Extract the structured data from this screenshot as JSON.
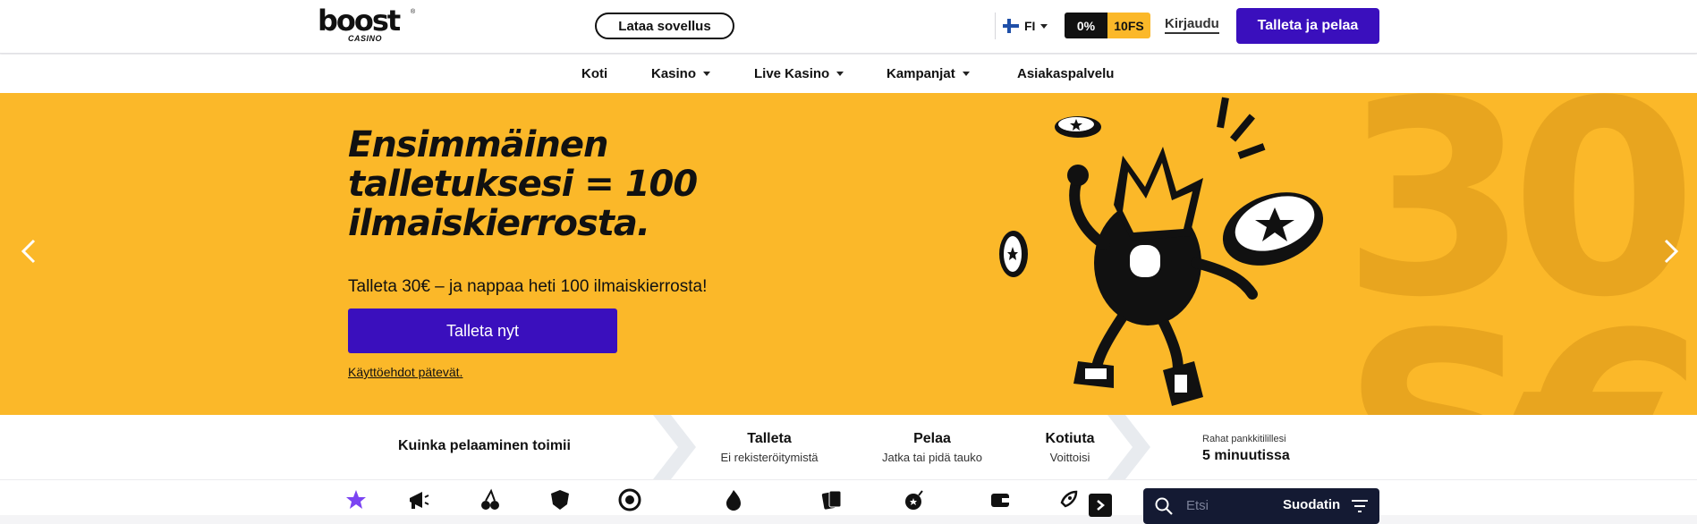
{
  "header": {
    "logo_text": "boost",
    "logo_sub": "CASINO",
    "app_button": "Lataa sovellus",
    "language": "FI",
    "bonus_left": "0%",
    "bonus_right": "10FS",
    "login": "Kirjaudu",
    "deposit_button": "Talleta ja pelaa"
  },
  "nav": {
    "items": [
      {
        "label": "Koti",
        "has_dropdown": false
      },
      {
        "label": "Kasino",
        "has_dropdown": true
      },
      {
        "label": "Live Kasino",
        "has_dropdown": true
      },
      {
        "label": "Kampanjat",
        "has_dropdown": true
      },
      {
        "label": "Asiakaspalvelu",
        "has_dropdown": false
      }
    ]
  },
  "hero": {
    "title": "Ensimmäinen talletuksesi = 100 ilmaiskierrosta.",
    "subtitle": "Talleta 30€ – ja nappaa heti 100 ilmaiskierrosta!",
    "cta": "Talleta nyt",
    "terms": "Käyttöehdot pätevät.",
    "background_color": "#fbb829"
  },
  "steps": {
    "heading": "Kuinka pelaaminen toimii",
    "items": [
      {
        "title": "Talleta",
        "sub": "Ei rekisteröitymistä"
      },
      {
        "title": "Pelaa",
        "sub": "Jatka tai pidä tauko"
      },
      {
        "title": "Kotiuta",
        "sub": "Voittoisi"
      }
    ],
    "payout_label": "Rahat pankkitilillesi",
    "payout_value": "5 minuutissa"
  },
  "categories": {
    "icons": [
      "star-icon",
      "megaphone-icon",
      "cherries-icon",
      "shield-icon",
      "roulette-icon",
      "flame-icon",
      "cards-icon",
      "bomb-icon",
      "wallet-icon",
      "rocket-icon"
    ],
    "search_placeholder": "Etsi",
    "filter_label": "Suodatin"
  },
  "colors": {
    "accent": "#3a0fbd",
    "yellow": "#fbb829",
    "dark": "#111111",
    "search_bg": "#141a33"
  }
}
